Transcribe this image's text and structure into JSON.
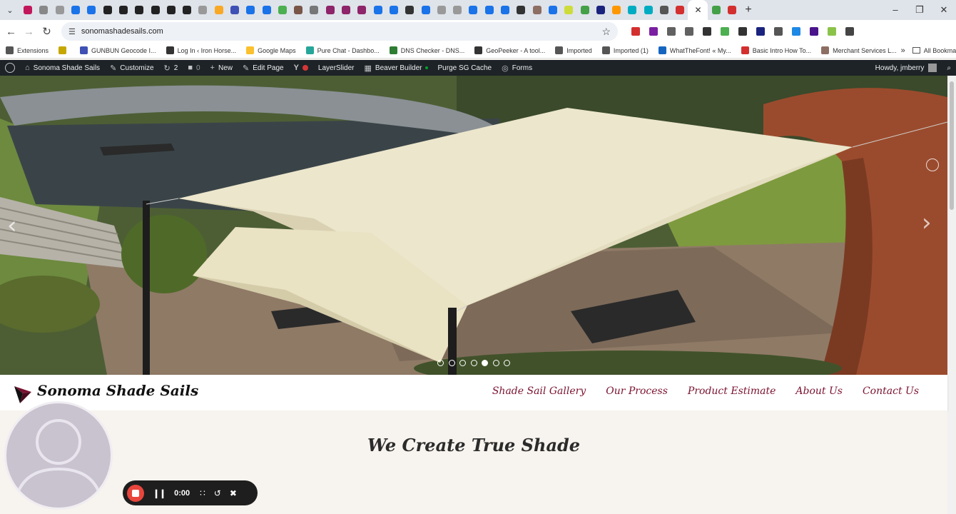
{
  "browser": {
    "url": "sonomashadesails.com",
    "tab_favicon_colors": [
      "#c2185b",
      "#888",
      "#999",
      "#1a73e8",
      "#1a73e8",
      "#222",
      "#222",
      "#222",
      "#222",
      "#222",
      "#222",
      "#999",
      "#f9a825",
      "#3f51b5",
      "#1a73e8",
      "#1a73e8",
      "#4caf50",
      "#795548",
      "#777",
      "#8e2469",
      "#8e2469",
      "#8e2469",
      "#1a73e8",
      "#1a73e8",
      "#333",
      "#1a73e8",
      "#999",
      "#999",
      "#1a73e8",
      "#1a73e8",
      "#1a73e8",
      "#333",
      "#8d6e63",
      "#1a73e8",
      "#cddc39",
      "#43a047",
      "#1a237e",
      "#ff9800",
      "#00acc1",
      "#00acc1",
      "#555",
      "#d32f2f",
      "#43a047",
      "#d32f2f"
    ],
    "extension_colors": [
      "#d32f2f",
      "#7b1fa2",
      "#616161",
      "#616161",
      "#333",
      "#4caf50",
      "#333",
      "#1a237e",
      "#555",
      "#1e88e5",
      "#4a148c",
      "#8bc34a",
      "#444"
    ],
    "bookmarks": [
      {
        "label": "Extensions",
        "color": "#555"
      },
      {
        "label": "",
        "color": "#c6a700"
      },
      {
        "label": "GUNBUN Geocode I...",
        "color": "#3f51b5"
      },
      {
        "label": "Log In ‹ Iron Horse...",
        "color": "#333"
      },
      {
        "label": "Google Maps",
        "color": "#fbc02d"
      },
      {
        "label": "Pure Chat - Dashbo...",
        "color": "#26a69a"
      },
      {
        "label": "DNS Checker - DNS...",
        "color": "#2e7d32"
      },
      {
        "label": "GeoPeeker - A tool...",
        "color": "#333"
      },
      {
        "label": "Imported",
        "color": "#555"
      },
      {
        "label": "Imported (1)",
        "color": "#555"
      },
      {
        "label": "WhatTheFont! « My...",
        "color": "#1565c0"
      },
      {
        "label": "Basic Intro How To...",
        "color": "#d32f2f"
      },
      {
        "label": "Merchant Services L...",
        "color": "#8d6e63"
      }
    ],
    "all_bookmarks": "All Bookmarks"
  },
  "adminbar": {
    "site_name": "Sonoma Shade Sails",
    "customize": "Customize",
    "updates": "2",
    "comments": "0",
    "new": "New",
    "edit_page": "Edit Page",
    "layerslider": "LayerSlider",
    "beaver_builder": "Beaver Builder",
    "purge_cache": "Purge SG Cache",
    "forms": "Forms",
    "howdy": "Howdy, jmberry"
  },
  "slider": {
    "dot_count": 7,
    "active_dot": 5
  },
  "site": {
    "logo_text": "Sonoma  Shade  Sails",
    "nav": [
      "Shade Sail Gallery",
      "Our Process",
      "Product Estimate",
      "About Us",
      "Contact Us"
    ],
    "tagline": "We Create True Shade",
    "accent_color": "#7a1230"
  },
  "recorder": {
    "time": "0:00"
  }
}
